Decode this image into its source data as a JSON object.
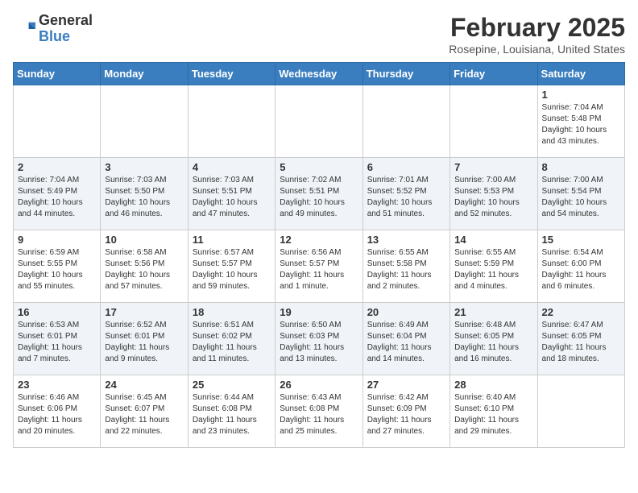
{
  "header": {
    "logo_line1": "General",
    "logo_line2": "Blue",
    "month_title": "February 2025",
    "location": "Rosepine, Louisiana, United States"
  },
  "weekdays": [
    "Sunday",
    "Monday",
    "Tuesday",
    "Wednesday",
    "Thursday",
    "Friday",
    "Saturday"
  ],
  "weeks": [
    [
      {
        "day": "",
        "info": ""
      },
      {
        "day": "",
        "info": ""
      },
      {
        "day": "",
        "info": ""
      },
      {
        "day": "",
        "info": ""
      },
      {
        "day": "",
        "info": ""
      },
      {
        "day": "",
        "info": ""
      },
      {
        "day": "1",
        "info": "Sunrise: 7:04 AM\nSunset: 5:48 PM\nDaylight: 10 hours and 43 minutes."
      }
    ],
    [
      {
        "day": "2",
        "info": "Sunrise: 7:04 AM\nSunset: 5:49 PM\nDaylight: 10 hours and 44 minutes."
      },
      {
        "day": "3",
        "info": "Sunrise: 7:03 AM\nSunset: 5:50 PM\nDaylight: 10 hours and 46 minutes."
      },
      {
        "day": "4",
        "info": "Sunrise: 7:03 AM\nSunset: 5:51 PM\nDaylight: 10 hours and 47 minutes."
      },
      {
        "day": "5",
        "info": "Sunrise: 7:02 AM\nSunset: 5:51 PM\nDaylight: 10 hours and 49 minutes."
      },
      {
        "day": "6",
        "info": "Sunrise: 7:01 AM\nSunset: 5:52 PM\nDaylight: 10 hours and 51 minutes."
      },
      {
        "day": "7",
        "info": "Sunrise: 7:00 AM\nSunset: 5:53 PM\nDaylight: 10 hours and 52 minutes."
      },
      {
        "day": "8",
        "info": "Sunrise: 7:00 AM\nSunset: 5:54 PM\nDaylight: 10 hours and 54 minutes."
      }
    ],
    [
      {
        "day": "9",
        "info": "Sunrise: 6:59 AM\nSunset: 5:55 PM\nDaylight: 10 hours and 55 minutes."
      },
      {
        "day": "10",
        "info": "Sunrise: 6:58 AM\nSunset: 5:56 PM\nDaylight: 10 hours and 57 minutes."
      },
      {
        "day": "11",
        "info": "Sunrise: 6:57 AM\nSunset: 5:57 PM\nDaylight: 10 hours and 59 minutes."
      },
      {
        "day": "12",
        "info": "Sunrise: 6:56 AM\nSunset: 5:57 PM\nDaylight: 11 hours and 1 minute."
      },
      {
        "day": "13",
        "info": "Sunrise: 6:55 AM\nSunset: 5:58 PM\nDaylight: 11 hours and 2 minutes."
      },
      {
        "day": "14",
        "info": "Sunrise: 6:55 AM\nSunset: 5:59 PM\nDaylight: 11 hours and 4 minutes."
      },
      {
        "day": "15",
        "info": "Sunrise: 6:54 AM\nSunset: 6:00 PM\nDaylight: 11 hours and 6 minutes."
      }
    ],
    [
      {
        "day": "16",
        "info": "Sunrise: 6:53 AM\nSunset: 6:01 PM\nDaylight: 11 hours and 7 minutes."
      },
      {
        "day": "17",
        "info": "Sunrise: 6:52 AM\nSunset: 6:01 PM\nDaylight: 11 hours and 9 minutes."
      },
      {
        "day": "18",
        "info": "Sunrise: 6:51 AM\nSunset: 6:02 PM\nDaylight: 11 hours and 11 minutes."
      },
      {
        "day": "19",
        "info": "Sunrise: 6:50 AM\nSunset: 6:03 PM\nDaylight: 11 hours and 13 minutes."
      },
      {
        "day": "20",
        "info": "Sunrise: 6:49 AM\nSunset: 6:04 PM\nDaylight: 11 hours and 14 minutes."
      },
      {
        "day": "21",
        "info": "Sunrise: 6:48 AM\nSunset: 6:05 PM\nDaylight: 11 hours and 16 minutes."
      },
      {
        "day": "22",
        "info": "Sunrise: 6:47 AM\nSunset: 6:05 PM\nDaylight: 11 hours and 18 minutes."
      }
    ],
    [
      {
        "day": "23",
        "info": "Sunrise: 6:46 AM\nSunset: 6:06 PM\nDaylight: 11 hours and 20 minutes."
      },
      {
        "day": "24",
        "info": "Sunrise: 6:45 AM\nSunset: 6:07 PM\nDaylight: 11 hours and 22 minutes."
      },
      {
        "day": "25",
        "info": "Sunrise: 6:44 AM\nSunset: 6:08 PM\nDaylight: 11 hours and 23 minutes."
      },
      {
        "day": "26",
        "info": "Sunrise: 6:43 AM\nSunset: 6:08 PM\nDaylight: 11 hours and 25 minutes."
      },
      {
        "day": "27",
        "info": "Sunrise: 6:42 AM\nSunset: 6:09 PM\nDaylight: 11 hours and 27 minutes."
      },
      {
        "day": "28",
        "info": "Sunrise: 6:40 AM\nSunset: 6:10 PM\nDaylight: 11 hours and 29 minutes."
      },
      {
        "day": "",
        "info": ""
      }
    ]
  ]
}
